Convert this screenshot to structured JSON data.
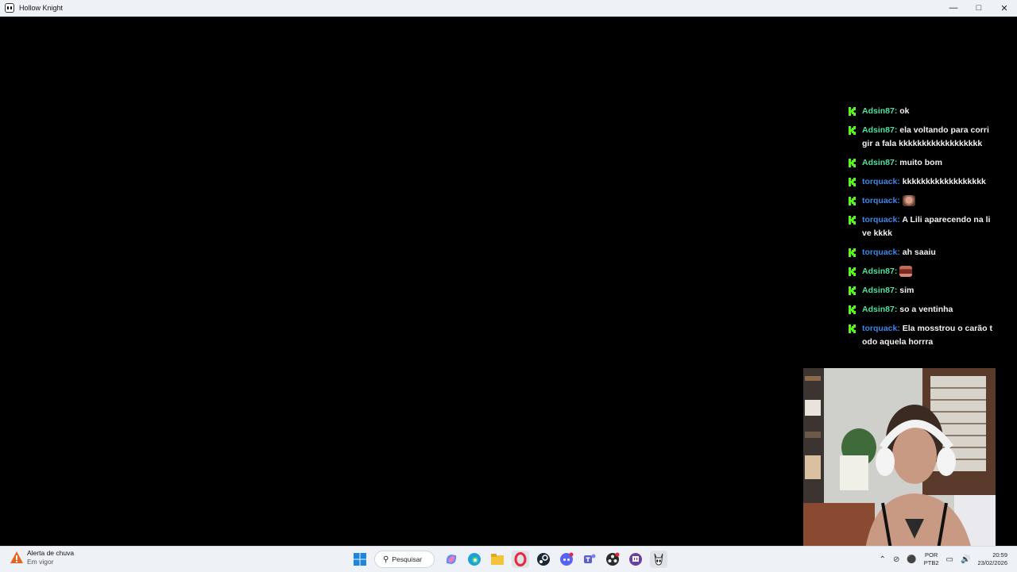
{
  "window": {
    "title": "Hollow Knight",
    "icon": "hollow-knight-icon",
    "controls": [
      "minimize",
      "maximize",
      "close"
    ]
  },
  "chat": {
    "platform_icon": "kick-icon",
    "accent": "#53fc18",
    "user_colors": {
      "Adsin87": "#4ee1a0",
      "torquack": "#3f86e6"
    },
    "messages": [
      {
        "user": "Adsin87:",
        "text": "ok",
        "emote": false,
        "color": "#4ee1a0"
      },
      {
        "user": "Adsin87:",
        "text": "ela voltando para corrigir a fala kkkkkkkkkkkkkkkkkk",
        "emote": false,
        "color": "#4ee1a0"
      },
      {
        "user": "Adsin87:",
        "text": "muito bom",
        "emote": false,
        "color": "#4ee1a0"
      },
      {
        "user": "torquack:",
        "text": "kkkkkkkkkkkkkkkkkk",
        "emote": false,
        "color": "#3f86e6"
      },
      {
        "user": "torquack:",
        "text": "",
        "emote": "face-emote",
        "color": "#3f86e6"
      },
      {
        "user": "torquack:",
        "text": "A Lili aparecendo na live kkkk",
        "emote": false,
        "color": "#3f86e6"
      },
      {
        "user": "torquack:",
        "text": "ah saaiu",
        "emote": false,
        "color": "#3f86e6"
      },
      {
        "user": "Adsin87:",
        "text": "",
        "emote": "mouth-emote",
        "color": "#4ee1a0"
      },
      {
        "user": "Adsin87:",
        "text": "sim",
        "emote": false,
        "color": "#4ee1a0"
      },
      {
        "user": "Adsin87:",
        "text": "so a ventinha",
        "emote": false,
        "color": "#4ee1a0"
      },
      {
        "user": "torquack:",
        "text": "Ela mosstrou o carão todo aquela horrra",
        "emote": false,
        "color": "#3f86e6"
      }
    ]
  },
  "taskbar": {
    "weather": {
      "title": "Alerta de chuva",
      "subtitle": "Em vigor",
      "icon": "weather-alert-icon"
    },
    "search_label": "Pesquisar",
    "apps": [
      "start-icon",
      "copilot-icon",
      "edge-icon",
      "file-explorer-icon",
      "opera-gx-icon",
      "steam-icon",
      "discord-icon",
      "teams-icon",
      "obs-icon",
      "twitch-icon",
      "hollow-knight-icon"
    ],
    "tray": {
      "lang_top": "POR",
      "lang_bottom": "PTB2",
      "time": "20:59",
      "date": "23/02/2026"
    }
  }
}
